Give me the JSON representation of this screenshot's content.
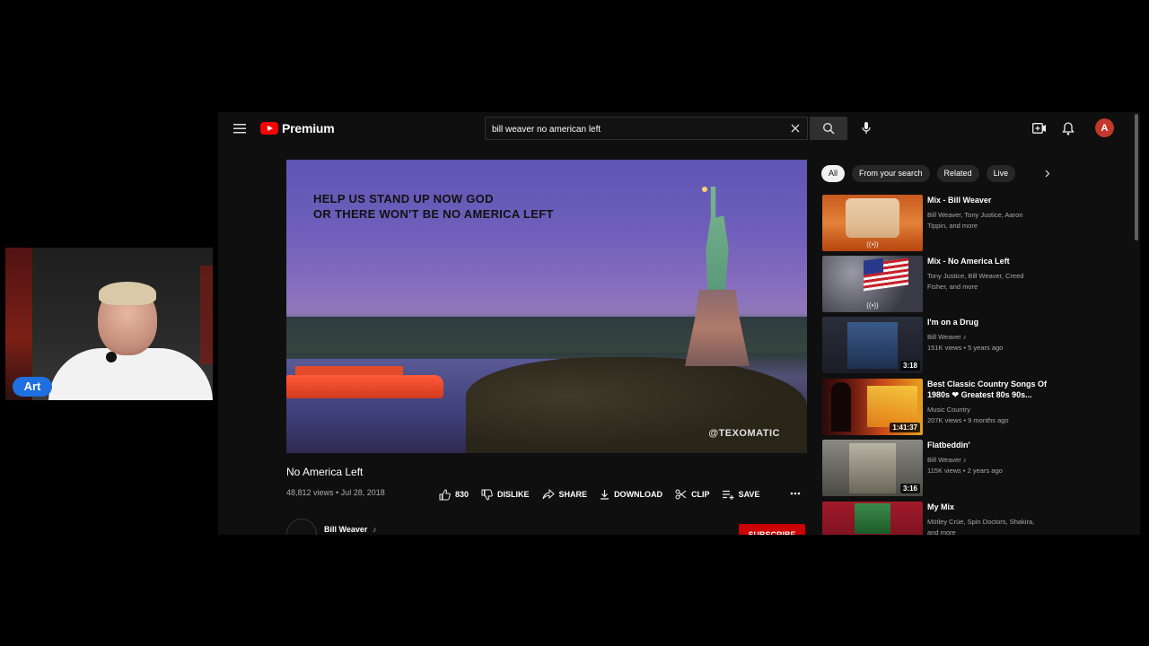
{
  "webcam": {
    "name_badge": "Art"
  },
  "header": {
    "logo_text": "Premium",
    "search_value": "bill weaver no american left",
    "avatar_letter": "A"
  },
  "video": {
    "overlay_caption_line1": "HELP US STAND UP NOW GOD",
    "overlay_caption_line2": "OR THERE WON'T BE NO AMERICA LEFT",
    "watermark": "@TEXOMATIC",
    "title": "No America Left",
    "meta": "48,812 views • Jul 28, 2018",
    "like_count": "830",
    "dislike_label": "DISLIKE",
    "share_label": "SHARE",
    "download_label": "DOWNLOAD",
    "clip_label": "CLIP",
    "save_label": "SAVE",
    "channel_name": "Bill Weaver",
    "channel_note": "♪",
    "subscribe_label": "SUBSCRIBE"
  },
  "chips": [
    "All",
    "From your search",
    "Related",
    "Live"
  ],
  "recommendations": [
    {
      "title": "Mix - Bill Weaver",
      "line1": "Bill Weaver, Tony Justice, Aaron",
      "line2": "Tippin, and more",
      "badge": "((•))"
    },
    {
      "title": "Mix - No America Left",
      "line1": "Tony Justice, Bill Weaver, Creed",
      "line2": "Fisher, and more",
      "badge": "((•))"
    },
    {
      "title": "I'm on a Drug",
      "line1": "Bill Weaver ♪",
      "line2": "151K views • 5 years ago",
      "badge": "3:18"
    },
    {
      "title": "Best Classic Country Songs Of 1980s ❤ Greatest 80s 90s...",
      "line1": "Music Country",
      "line2": "207K views • 9 months ago",
      "badge": "1:41:37"
    },
    {
      "title": "Flatbeddin'",
      "line1": "Bill Weaver ♪",
      "line2": "115K views • 2 years ago",
      "badge": "3:16"
    },
    {
      "title": "My Mix",
      "line1": "Mötley Crüe, Spin Doctors, Shakira,",
      "line2": "and more",
      "badge": ""
    }
  ],
  "colors": {
    "accent": "#ff0000",
    "background": "#0f0f0f",
    "chip_bg": "#272727",
    "subscribe": "#cc0000"
  }
}
